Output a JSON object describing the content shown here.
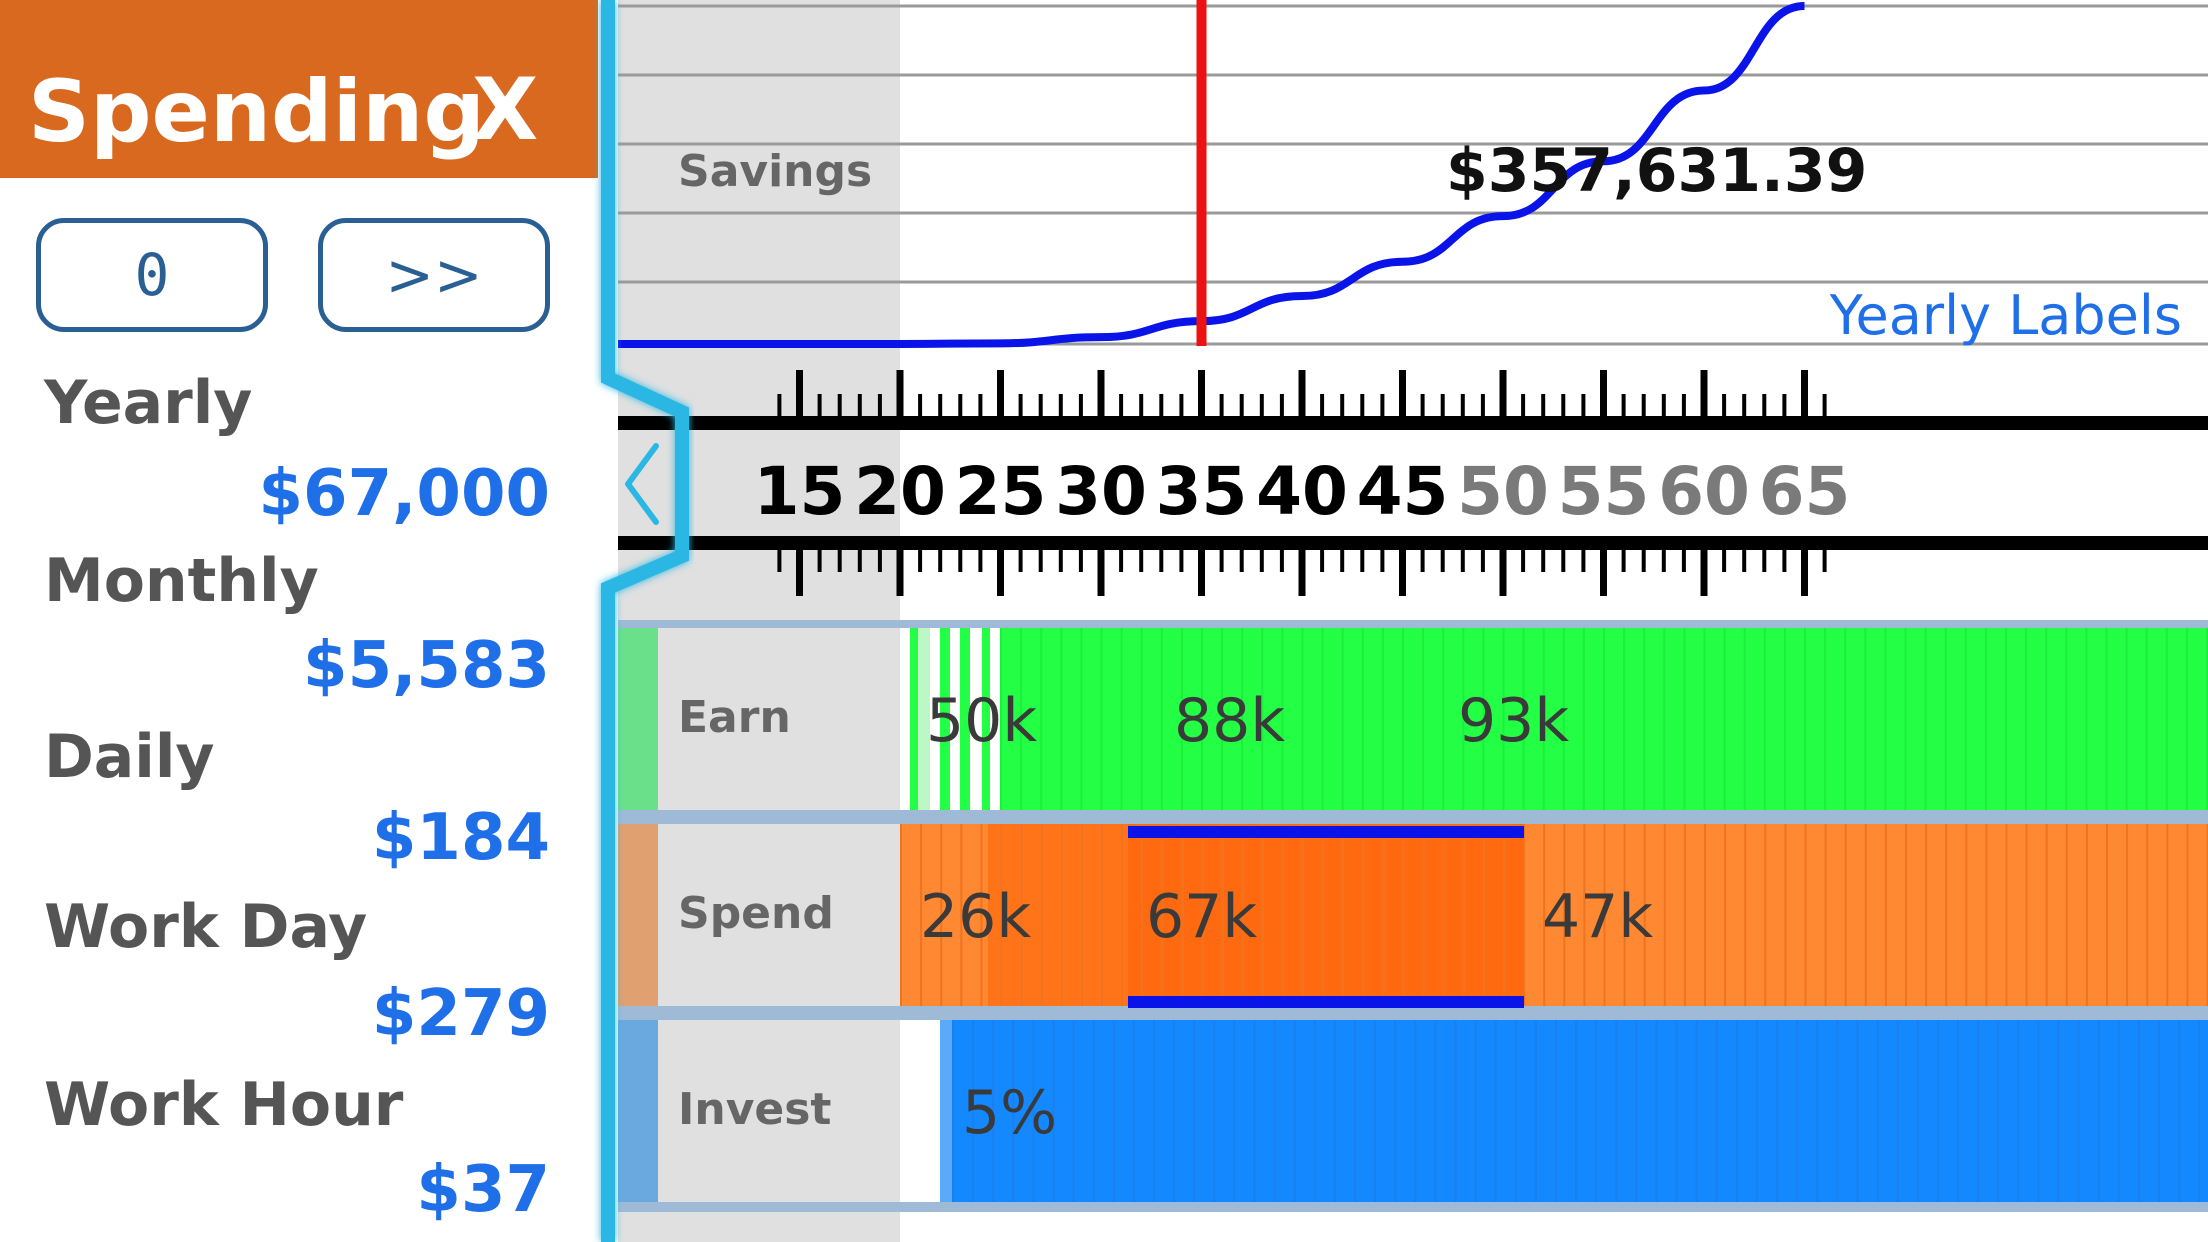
{
  "panel": {
    "title": "Spending",
    "close_label": "X",
    "zero_button": "0",
    "next_button": ">>",
    "rates": [
      {
        "label": "Yearly",
        "value": "$67,000"
      },
      {
        "label": "Monthly",
        "value": "$5,583"
      },
      {
        "label": "Daily",
        "value": "$184"
      },
      {
        "label": "Work Day",
        "value": "$279"
      },
      {
        "label": "Work Hour",
        "value": "$37"
      }
    ]
  },
  "collapse_icon": "chevron-left-icon",
  "savings": {
    "label": "Savings",
    "value": "$357,631.39",
    "link": "Yearly Labels"
  },
  "ruler": {
    "ages": [
      "15",
      "20",
      "25",
      "30",
      "35",
      "40",
      "45",
      "50",
      "55",
      "60",
      "65"
    ],
    "current_age": 35,
    "past_age": 20
  },
  "bands": {
    "earn": {
      "label": "Earn",
      "values": [
        "50k",
        "88k",
        "93k"
      ]
    },
    "spend": {
      "label": "Spend",
      "values": [
        "26k",
        "67k",
        "47k"
      ]
    },
    "invest": {
      "label": "Invest",
      "values": [
        "5%"
      ]
    }
  },
  "chart_data": {
    "type": "line",
    "x": [
      20,
      25,
      30,
      35,
      40,
      45,
      50,
      55,
      60,
      65
    ],
    "series": [
      {
        "values": [
          0,
          3000,
          30000,
          100000,
          210000,
          360000,
          560000,
          800000,
          1110000,
          1480000
        ]
      }
    ]
  },
  "colors": {
    "header": "#d9691f",
    "accent_blue": "#1f6fe8",
    "earn": "#22ff44",
    "spend": "#ff8833",
    "spend_selected": "#ff6a10",
    "invest": "#1488ff",
    "marker": "#ee1111",
    "curve": "#0a14e8"
  }
}
